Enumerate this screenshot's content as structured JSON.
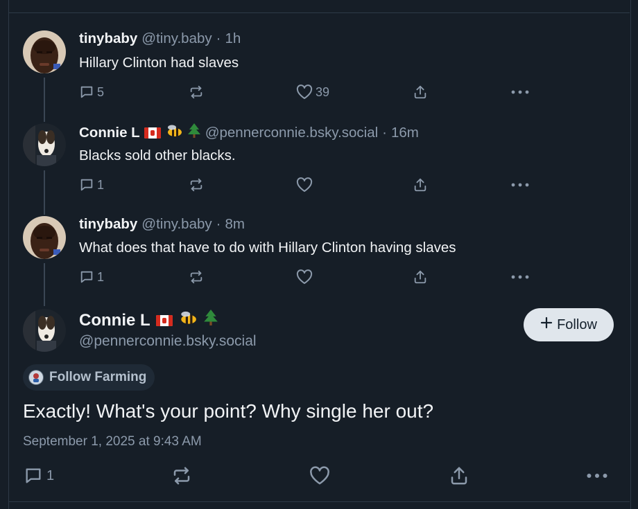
{
  "replies": [
    {
      "name": "tinybaby",
      "handle": "@tiny.baby",
      "sep": "·",
      "time": "1h",
      "text": "Hillary Clinton had slaves",
      "reply_count": "5",
      "repost_count": "",
      "like_count": "39"
    },
    {
      "name": "Connie L",
      "handle": "@pennerconnie.bsky.social",
      "sep": "·",
      "time": "16m",
      "text": "Blacks sold other blacks.",
      "reply_count": "1",
      "repost_count": "",
      "like_count": ""
    },
    {
      "name": "tinybaby",
      "handle": "@tiny.baby",
      "sep": "·",
      "time": "8m",
      "text": "What does that have to do with Hillary Clinton having slaves",
      "reply_count": "1",
      "repost_count": "",
      "like_count": ""
    }
  ],
  "main_post": {
    "name": "Connie L",
    "handle": "@pennerconnie.bsky.social",
    "follow_label": "Follow",
    "follow_icon": "plus-icon",
    "chip_label": "Follow Farming",
    "text": "Exactly! What's your point? Why single her out?",
    "date": "September 1, 2025 at 9:43 AM",
    "reply_count": "1"
  },
  "icons": [
    "reply-icon",
    "repost-icon",
    "like-icon",
    "share-icon",
    "more-icon",
    "canada-flag-icon",
    "bee-icon",
    "pine-tree-icon"
  ],
  "colors": {
    "background": "#161e27",
    "text": "#f1f3f5",
    "muted": "#8c9aab",
    "button_bg": "#e0e6ec",
    "chip_bg": "#1f2a36"
  }
}
